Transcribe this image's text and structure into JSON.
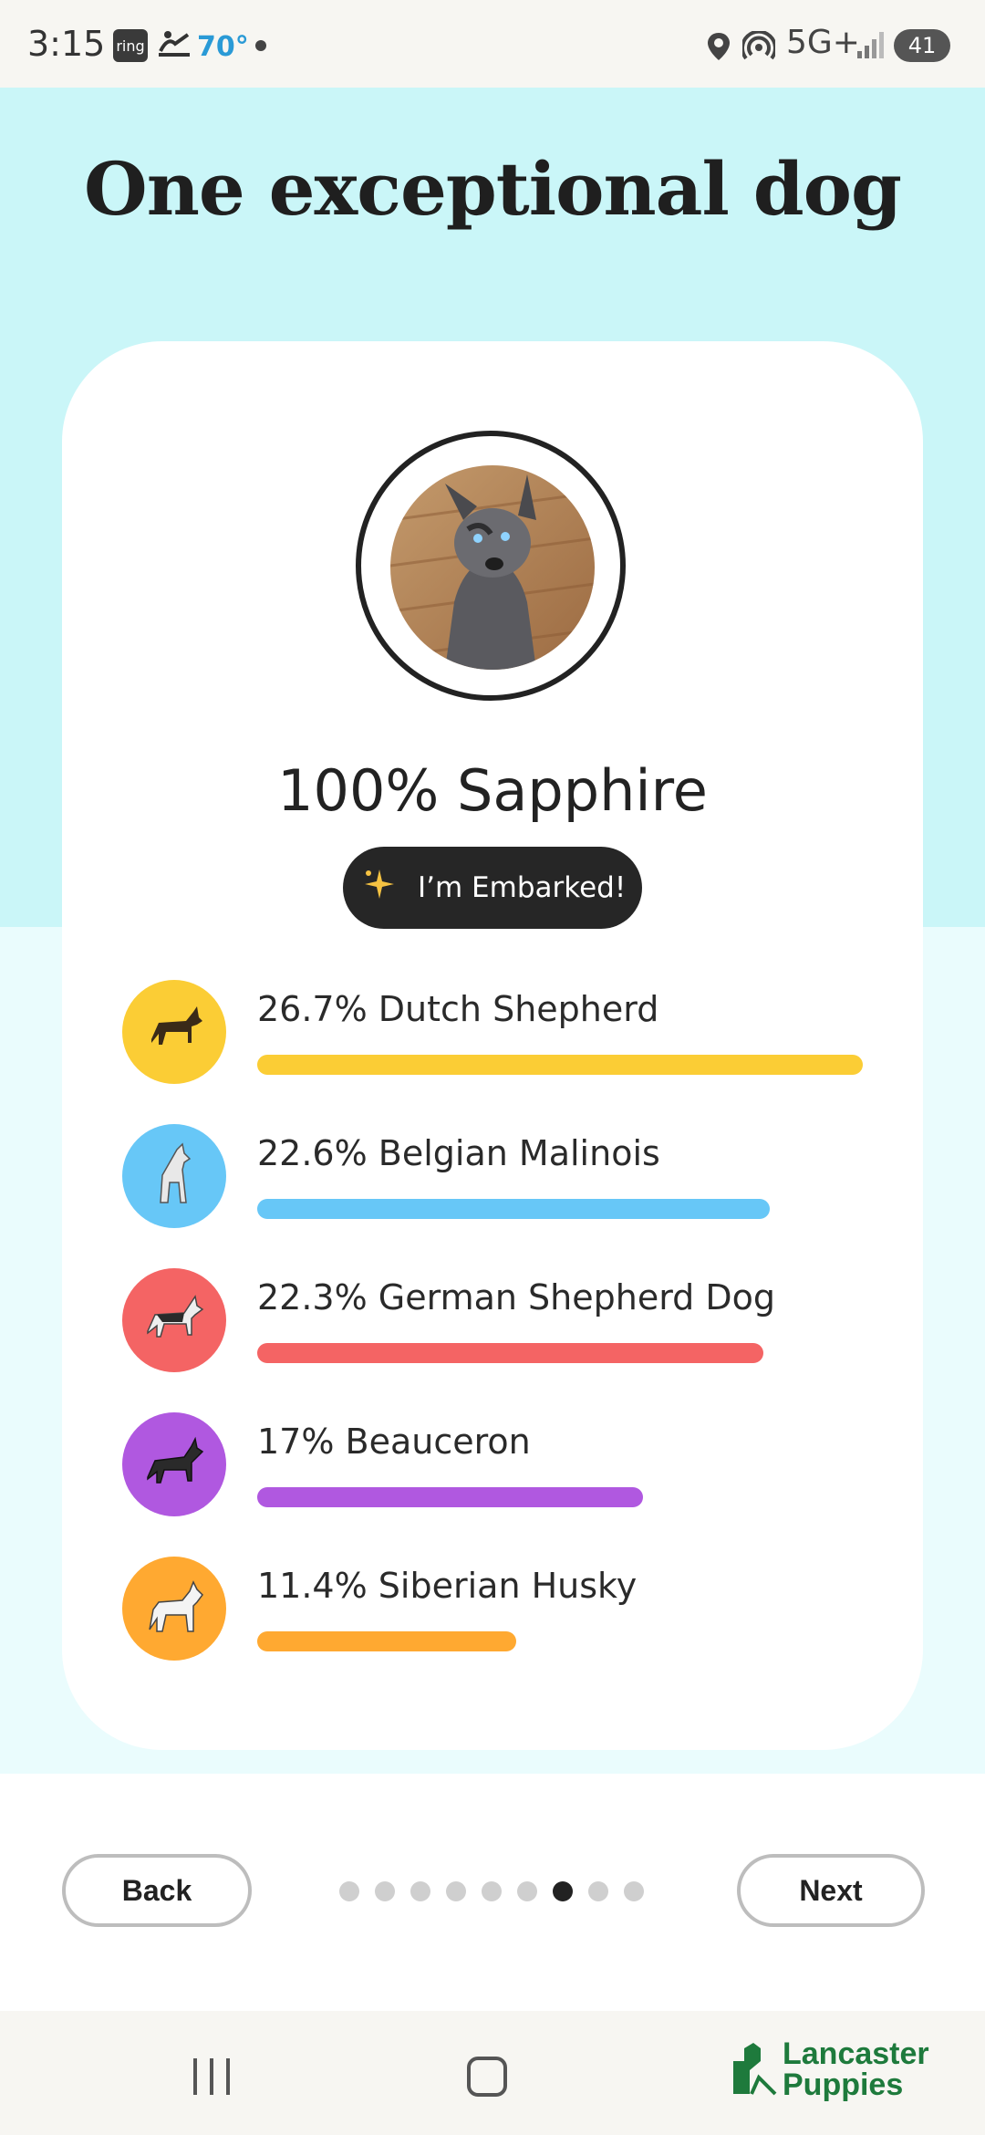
{
  "status_bar": {
    "time": "3:15",
    "ring_label": "ring",
    "temperature": "70°",
    "network": "5G+",
    "battery": "41"
  },
  "page": {
    "headline": "One exceptional dog",
    "dog_name": "100% Sapphire",
    "embark_badge": "I’m Embarked!"
  },
  "breeds": [
    {
      "label": "26.7% Dutch Shepherd",
      "percent": 26.7,
      "color": "#fbcd35",
      "icon": "dutch-shepherd-illustration"
    },
    {
      "label": "22.6% Belgian Malinois",
      "percent": 22.6,
      "color": "#67c7f7",
      "icon": "belgian-malinois-illustration"
    },
    {
      "label": "22.3% German Shepherd Dog",
      "percent": 22.3,
      "color": "#f46464",
      "icon": "german-shepherd-illustration"
    },
    {
      "label": "17% Beauceron",
      "percent": 17,
      "color": "#b058e0",
      "icon": "beauceron-illustration"
    },
    {
      "label": "11.4% Siberian Husky",
      "percent": 11.4,
      "color": "#ffa931",
      "icon": "siberian-husky-illustration"
    }
  ],
  "navigation": {
    "back_label": "Back",
    "next_label": "Next",
    "page_count": 9,
    "active_page": 7
  },
  "brand": {
    "line1": "Lancaster",
    "line2": "Puppies",
    "color": "#1e7a3c"
  }
}
